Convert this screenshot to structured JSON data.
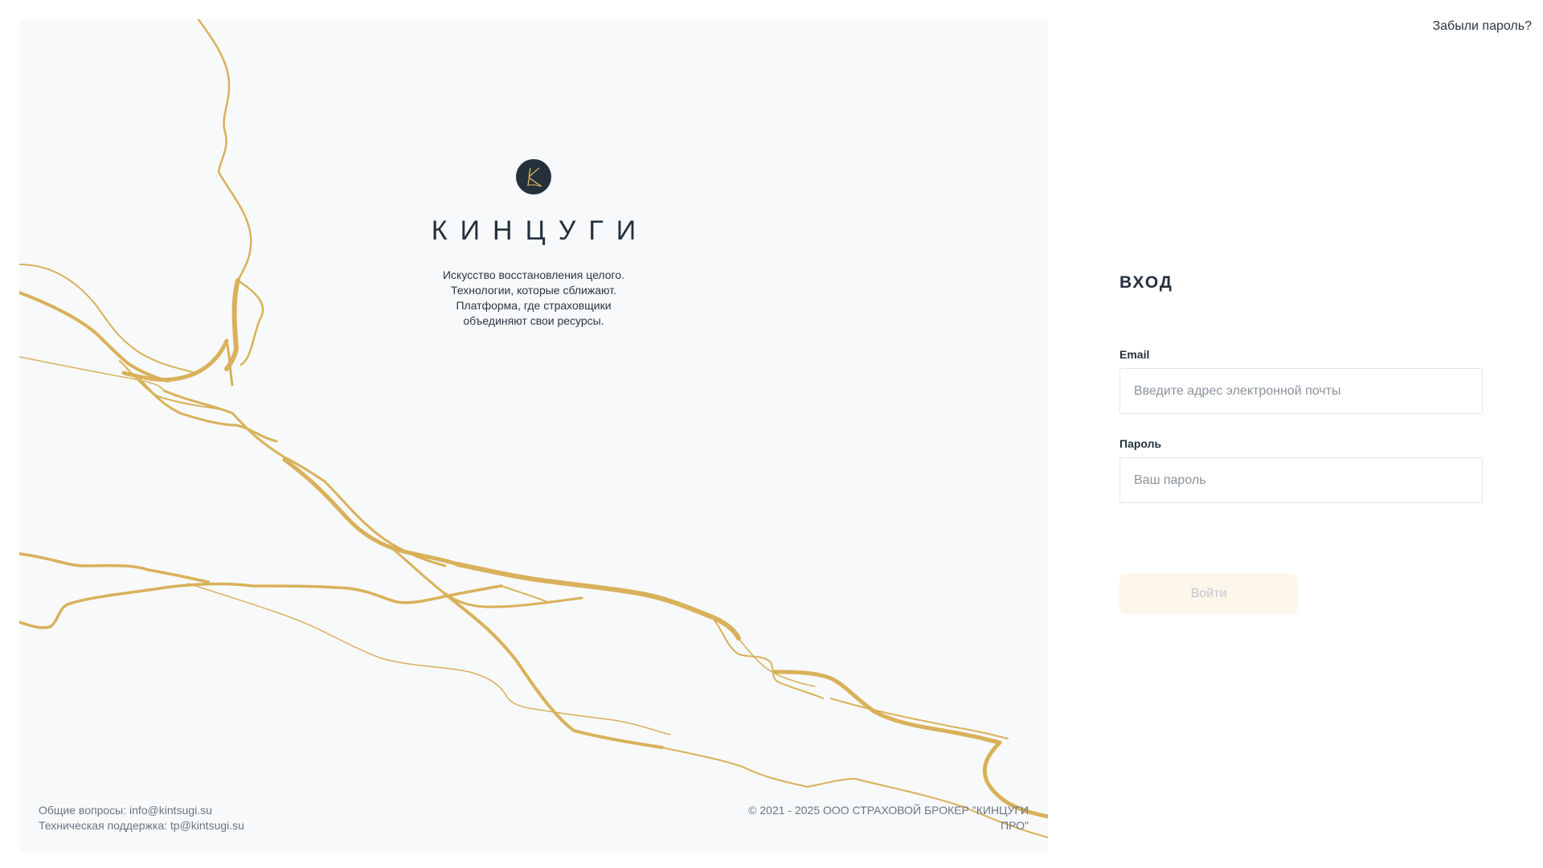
{
  "brand": {
    "name": "КИНЦУГИ",
    "tagline": "Искусство восстановления целого. Технологии, которые сближают. Платформа, где страховщики объединяют свои ресурсы."
  },
  "header": {
    "forgot_password": "Забыли пароль?"
  },
  "login": {
    "title": "ВХОД",
    "email_label": "Email",
    "email_placeholder": "Введите адрес электронной почты",
    "email_value": "",
    "password_label": "Пароль",
    "password_placeholder": "Ваш пароль",
    "password_value": "",
    "submit_label": "Войти",
    "submit_disabled": true
  },
  "footer": {
    "general_questions": "Общие вопросы: info@kintsugi.su",
    "tech_support": "Техническая поддержка: tp@kintsugi.su",
    "copyright": "©  2021 - 2025 ООО СТРАХОВОЙ БРОКЕР \"КИНЦУГИ ПРО\""
  },
  "colors": {
    "panel_background": "#f8f9fa",
    "gold": "#d9b15a",
    "dark": "#24303c",
    "button_disabled_bg": "#fcf6eb",
    "button_disabled_text": "#c3c8ce"
  },
  "icons": {
    "logo": "kintsugi-logo-icon"
  }
}
